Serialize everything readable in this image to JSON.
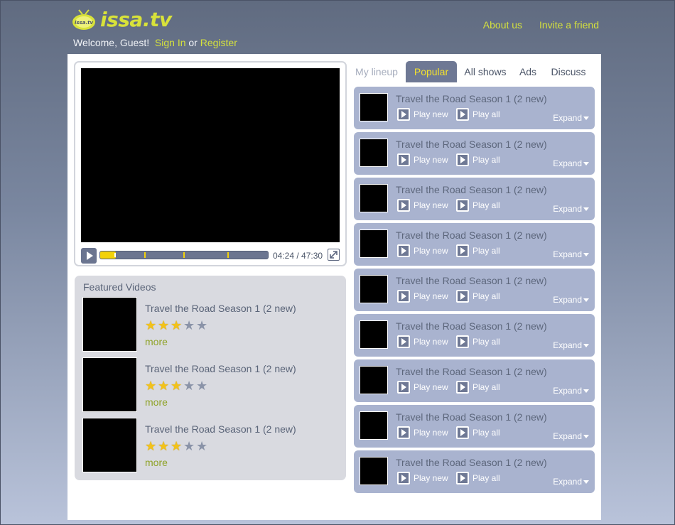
{
  "header": {
    "logo_text": "issa.tv",
    "logo_badge": "issa.tv",
    "welcome_text": "Welcome, Guest!",
    "sign_in": "Sign In",
    "or_text": "or",
    "register": "Register",
    "about_us": "About us",
    "invite": "Invite a friend"
  },
  "player": {
    "time": "04:24 / 47:30",
    "progress_fraction": 0.093
  },
  "featured": {
    "title": "Featured Videos",
    "items": [
      {
        "title": "Travel the Road Season 1 (2 new)",
        "rating": 3,
        "max_rating": 5,
        "more": "more"
      },
      {
        "title": "Travel the Road Season 1 (2 new)",
        "rating": 3,
        "max_rating": 5,
        "more": "more"
      },
      {
        "title": "Travel the Road Season 1 (2 new)",
        "rating": 3,
        "max_rating": 5,
        "more": "more"
      }
    ]
  },
  "tabs": [
    {
      "label": "My lineup",
      "state": "dim"
    },
    {
      "label": "Popular",
      "state": "active"
    },
    {
      "label": "All shows",
      "state": "normal"
    },
    {
      "label": "Ads",
      "state": "normal"
    },
    {
      "label": "Discuss",
      "state": "normal"
    }
  ],
  "lineup": [
    {
      "title": "Travel the Road Season 1 (2 new)",
      "play_new": "Play new",
      "play_all": "Play all",
      "expand": "Expand"
    },
    {
      "title": "Travel the Road Season 1 (2 new)",
      "play_new": "Play new",
      "play_all": "Play all",
      "expand": "Expand"
    },
    {
      "title": "Travel the Road Season 1 (2 new)",
      "play_new": "Play new",
      "play_all": "Play all",
      "expand": "Expand"
    },
    {
      "title": "Travel the Road Season 1 (2 new)",
      "play_new": "Play new",
      "play_all": "Play all",
      "expand": "Expand"
    },
    {
      "title": "Travel the Road Season 1 (2 new)",
      "play_new": "Play new",
      "play_all": "Play all",
      "expand": "Expand"
    },
    {
      "title": "Travel the Road Season 1 (2 new)",
      "play_new": "Play new",
      "play_all": "Play all",
      "expand": "Expand"
    },
    {
      "title": "Travel the Road Season 1 (2 new)",
      "play_new": "Play new",
      "play_all": "Play all",
      "expand": "Expand"
    },
    {
      "title": "Travel the Road Season 1 (2 new)",
      "play_new": "Play new",
      "play_all": "Play all",
      "expand": "Expand"
    },
    {
      "title": "Travel the Road Season 1 (2 new)",
      "play_new": "Play new",
      "play_all": "Play all",
      "expand": "Expand"
    }
  ],
  "colors": {
    "accent": "#d4e03e",
    "tab_active_bg": "#6e7894",
    "list_item_bg": "#a9b3cf",
    "star_on": "#f2c21a",
    "star_off": "#8a93a8"
  },
  "icons": [
    "tv-logo-icon",
    "play-icon",
    "fullscreen-icon",
    "star-icon",
    "chevron-down-icon"
  ]
}
